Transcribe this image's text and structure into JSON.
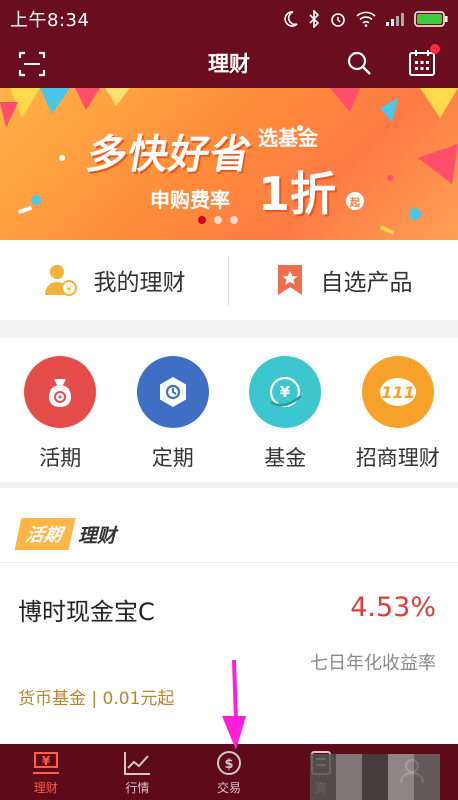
{
  "status_bar": {
    "time": "上午8:34"
  },
  "header": {
    "title": "理财"
  },
  "banner": {
    "title": "多快好省",
    "select_fund": "选基金",
    "fee_rate": "申购费率",
    "discount": "1折",
    "qi": "起",
    "dots": 3,
    "active_dot": 0
  },
  "quick_links": [
    {
      "label": "我的理财",
      "icon": "my-finance-icon"
    },
    {
      "label": "自选产品",
      "icon": "favorites-bookmark-icon"
    }
  ],
  "categories": [
    {
      "label": "活期",
      "color": "#e44b4b",
      "icon": "money-bag-icon"
    },
    {
      "label": "定期",
      "color": "#3f6fc3",
      "icon": "hexagon-clock-icon"
    },
    {
      "label": "基金",
      "color": "#3dc6ce",
      "icon": "yen-chart-icon"
    },
    {
      "label": "招商理财",
      "color": "#f6a22a",
      "icon": "wealth-logo-icon"
    }
  ],
  "current_section": {
    "badge": "活期",
    "title": "理财",
    "product": {
      "name": "博时现金宝C",
      "rate": "4.53%",
      "rate_label": "七日年化收益率",
      "type": "货币基金 | 0.01元起"
    }
  },
  "tab_bar": [
    {
      "label": "理财",
      "icon": "yen-box-icon",
      "active": true
    },
    {
      "label": "行情",
      "icon": "chart-line-icon",
      "active": false
    },
    {
      "label": "交易",
      "icon": "dollar-cycle-icon",
      "active": false
    },
    {
      "label": "资",
      "icon": "document-icon",
      "active": false
    },
    {
      "label": "",
      "icon": "user-icon",
      "active": false
    }
  ],
  "colors": {
    "header_bg": "#6a0d1e",
    "tab_bg": "#5e0b19",
    "accent_red": "#e03a3a",
    "gold": "#b8862a"
  }
}
